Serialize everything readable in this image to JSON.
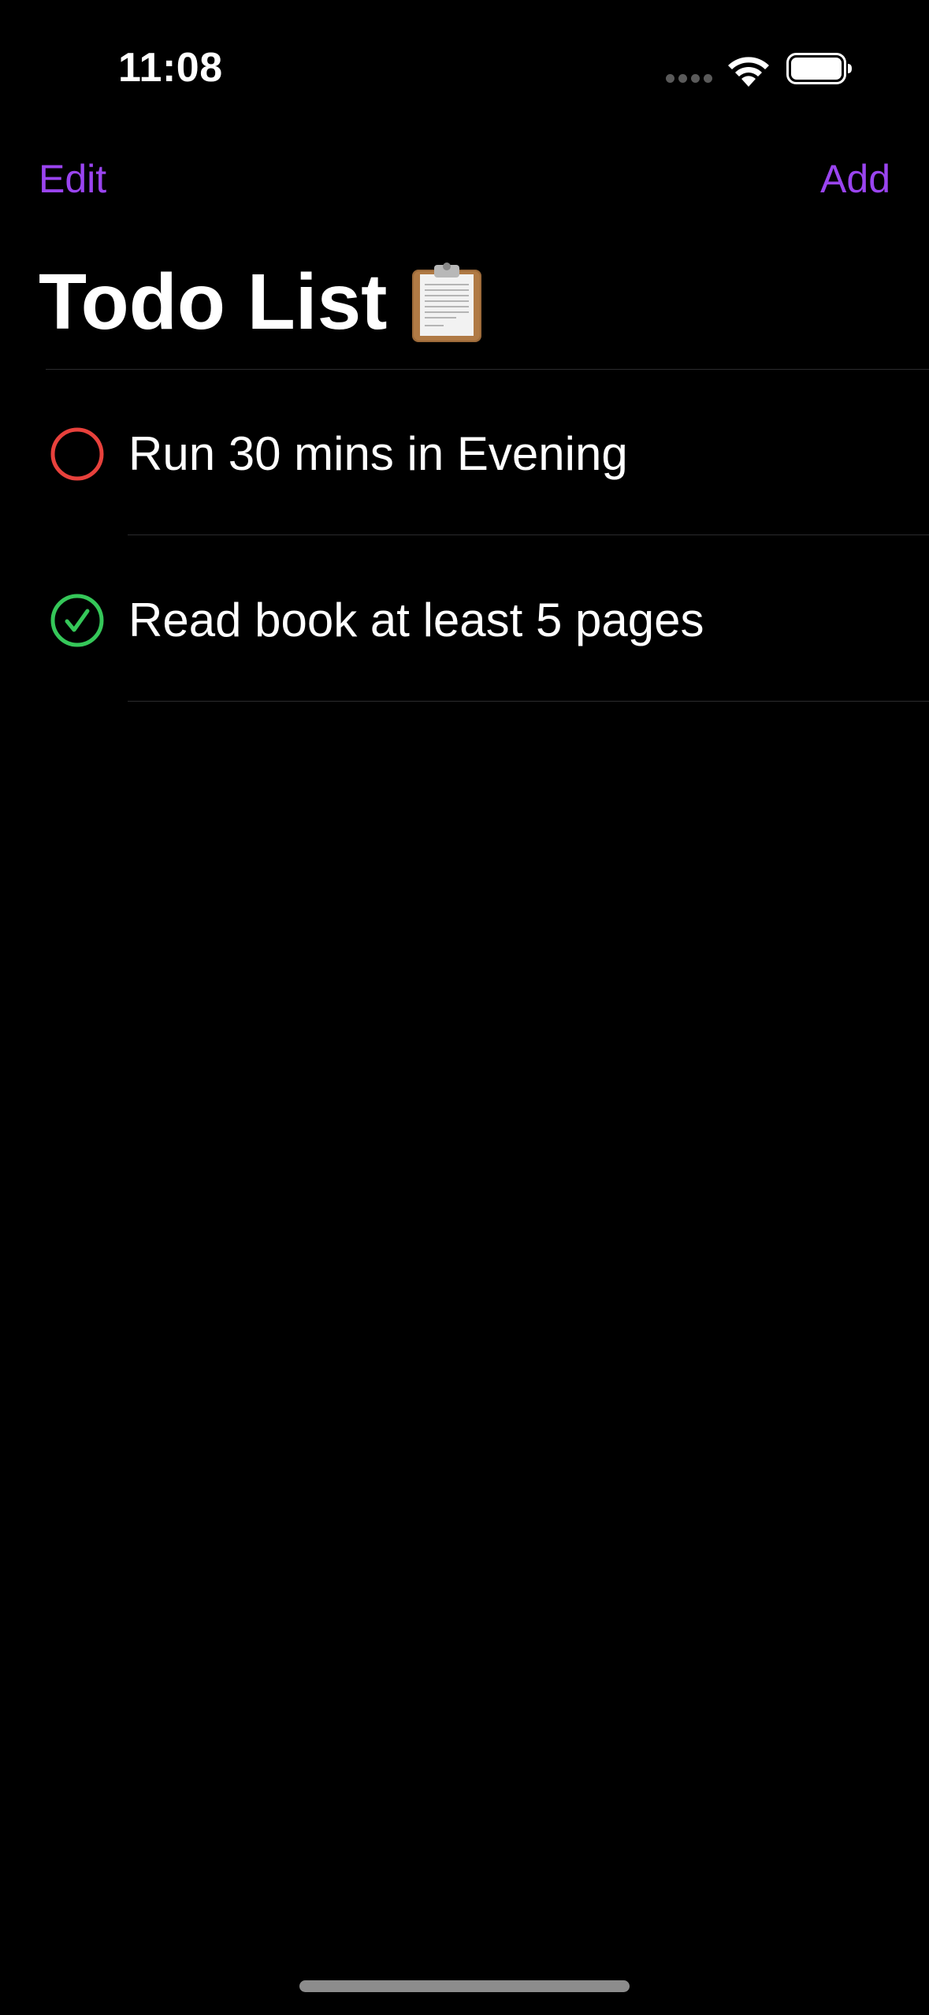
{
  "status_bar": {
    "time": "11:08",
    "signal_icon": "cellular-signal-icon",
    "wifi_icon": "wifi-icon",
    "battery_icon": "battery-full-icon"
  },
  "nav": {
    "edit_label": "Edit",
    "add_label": "Add"
  },
  "title": {
    "text": "Todo List",
    "icon": "clipboard-icon"
  },
  "todos": [
    {
      "text": "Run 30 mins in Evening",
      "completed": false,
      "status_icon": "empty-circle-icon",
      "status_color": "#e8413c"
    },
    {
      "text": "Read book at least 5 pages",
      "completed": true,
      "status_icon": "checkmark-circle-icon",
      "status_color": "#35c759"
    }
  ],
  "colors": {
    "accent": "#9a44f0",
    "background": "#000000",
    "separator": "#2b2b2d",
    "text": "#ffffff"
  }
}
